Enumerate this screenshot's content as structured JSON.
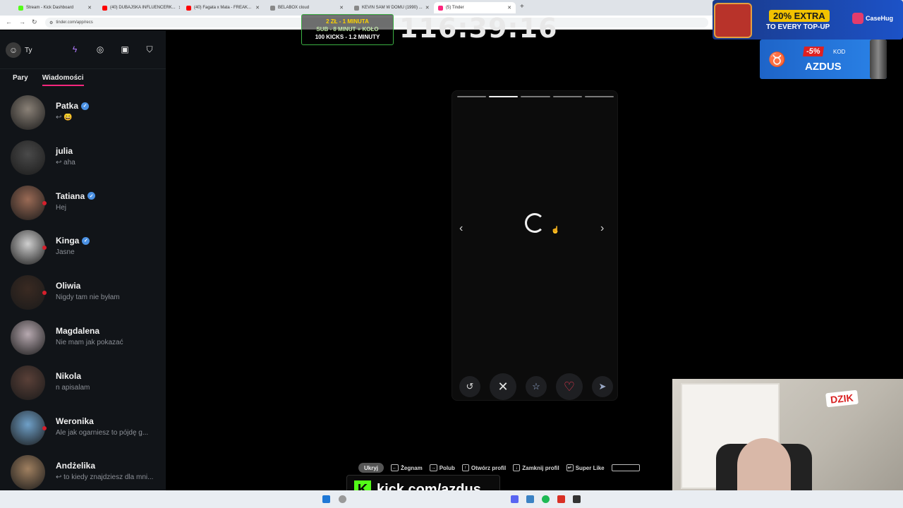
{
  "browser": {
    "tabs": [
      {
        "title": "Stream - Kick Dashboard",
        "color": "#53fc18"
      },
      {
        "title": "(40) DUBAJSKA INFLUENCERK...",
        "color": "#ff0000"
      },
      {
        "title": "(40) Fagata x Mata - FREAK...",
        "color": "#ff0000"
      },
      {
        "title": "BELABOX cloud",
        "color": "#888888"
      },
      {
        "title": "KEVIN SAM W DOMU (1990) ...",
        "color": "#888888"
      },
      {
        "title": "(5) Tinder",
        "color": "#fd267d"
      }
    ],
    "url": "tinder.com/app/recs"
  },
  "sidebar": {
    "user": "Ty",
    "tabs": [
      "Pary",
      "Wiadomości"
    ],
    "active_tab": "Wiadomości",
    "conversations": [
      {
        "name": "Patka",
        "message": "↩ 😄",
        "verified": true,
        "unread": false
      },
      {
        "name": "julia",
        "message": "↩ aha",
        "verified": false,
        "unread": false
      },
      {
        "name": "Tatiana",
        "message": "Hej",
        "verified": true,
        "unread": true
      },
      {
        "name": "Kinga",
        "message": "Jasne",
        "verified": true,
        "unread": true
      },
      {
        "name": "Oliwia",
        "message": "Nigdy tam nie byłam",
        "verified": false,
        "unread": true
      },
      {
        "name": "Magdalena",
        "message": "Nie mam jak pokazać",
        "verified": false,
        "unread": false
      },
      {
        "name": "Nikola",
        "message": "n apisalam",
        "verified": false,
        "unread": false
      },
      {
        "name": "Weronika",
        "message": "Ale jak ogarniesz to pójdę g...",
        "verified": false,
        "unread": true
      },
      {
        "name": "Andżelika",
        "message": "↩ to kiedy znajdziesz dla mni...",
        "verified": false,
        "unread": false
      }
    ]
  },
  "card": {
    "photo_count": 5,
    "active_photo": 2
  },
  "hints": {
    "hide": "Ukryj",
    "items": [
      "Żegnam",
      "Polub",
      "Otwórz profil",
      "Zamknij profil",
      "Super Like"
    ]
  },
  "overlay": {
    "subathon": {
      "line1": "2 ZŁ - 1 MINUTA",
      "line2": "SUB - 8 MINUT + KOŁO",
      "line3": "100 KICKS - 1.2 MINUTY"
    },
    "timer": "116:39:16",
    "promo1": {
      "big": "20% EXTRA",
      "small": "TO EVERY TOP-UP",
      "brand": "CaseHug"
    },
    "promo2": {
      "pct": "-5%",
      "kod": "KOD",
      "code": "AZDUS"
    },
    "webcam_brand": "DZIK",
    "kick": "kick.com/azdus"
  }
}
